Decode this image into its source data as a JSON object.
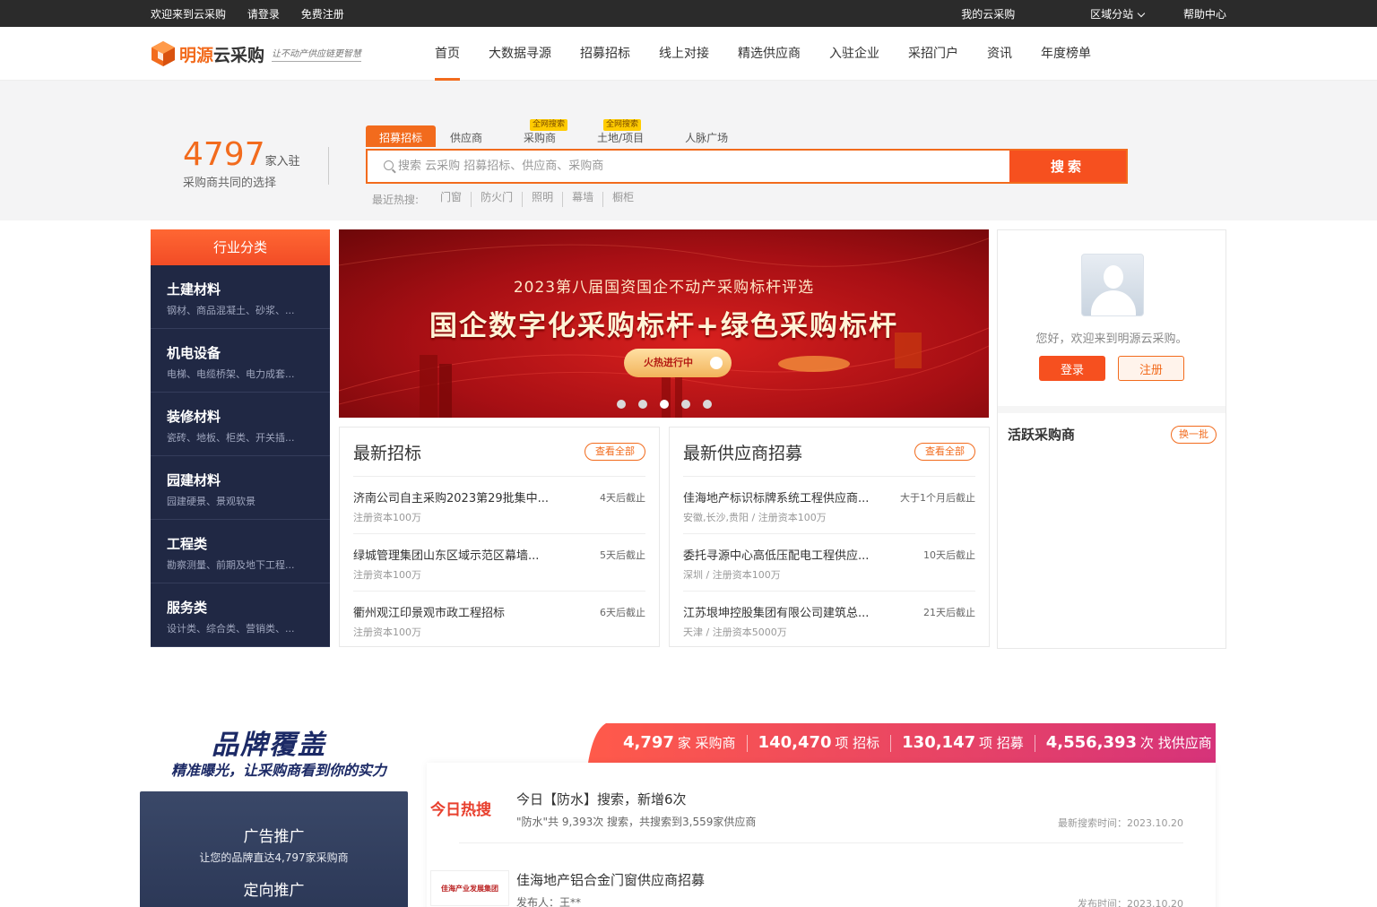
{
  "topbar": {
    "welcome": "欢迎来到云采购",
    "login": "请登录",
    "register": "免费注册",
    "my": "我的云采购",
    "region": "区域分站",
    "help": "帮助中心"
  },
  "header": {
    "logo_brand": "明源",
    "logo_product": "云采购",
    "slogan": "让不动产供应链更智慧",
    "nav": [
      "首页",
      "大数据寻源",
      "招募招标",
      "线上对接",
      "精选供应商",
      "入驻企业",
      "采招门户",
      "资讯",
      "年度榜单"
    ],
    "active_nav": "首页"
  },
  "search": {
    "stat_number": "4797",
    "stat_unit": "家入驻",
    "stat_sub": "采购商共同的选择",
    "tabs": [
      {
        "label": "招募招标",
        "badge": ""
      },
      {
        "label": "供应商",
        "badge": ""
      },
      {
        "label": "采购商",
        "badge": "全网搜索"
      },
      {
        "label": "土地/项目",
        "badge": "全网搜索"
      },
      {
        "label": "人脉广场",
        "badge": ""
      }
    ],
    "placeholder": "搜索 云采购 招募招标、供应商、采购商",
    "button": "搜索",
    "hot_label": "最近热搜:",
    "hot": [
      "门窗",
      "防火门",
      "照明",
      "幕墙",
      "橱柜"
    ]
  },
  "categories": {
    "title": "行业分类",
    "items": [
      {
        "title": "土建材料",
        "desc": "钢材、商品混凝土、砂浆、..."
      },
      {
        "title": "机电设备",
        "desc": "电梯、电缆桥架、电力成套..."
      },
      {
        "title": "装修材料",
        "desc": "瓷砖、地板、柜类、开关插..."
      },
      {
        "title": "园建材料",
        "desc": "园建硬景、景观软景"
      },
      {
        "title": "工程类",
        "desc": "勘察测量、前期及地下工程..."
      },
      {
        "title": "服务类",
        "desc": "设计类、综合类、营销类、..."
      }
    ]
  },
  "banner": {
    "subtitle": "2023第八届国资国企不动产采购标杆评选",
    "title": "国企数字化采购标杆+绿色采购标杆",
    "button": "火热进行中",
    "slide_count": 5,
    "active_slide": 2
  },
  "tenders": {
    "title": "最新招标",
    "view_all": "查看全部",
    "rows": [
      {
        "title": "济南公司自主采购2023第29批集中...",
        "sub": "注册资本100万",
        "deadline": "4天后截止"
      },
      {
        "title": "绿城管理集团山东区域示范区幕墙...",
        "sub": "注册资本100万",
        "deadline": "5天后截止"
      },
      {
        "title": "衢州观江印景观市政工程招标",
        "sub": "注册资本100万",
        "deadline": "6天后截止"
      }
    ]
  },
  "suppliers": {
    "title": "最新供应商招募",
    "view_all": "查看全部",
    "rows": [
      {
        "title": "佳海地产标识标牌系统工程供应商...",
        "sub": "安徽,长沙,贵阳 / 注册资本100万",
        "deadline": "大于1个月后截止"
      },
      {
        "title": "委托寻源中心高低压配电工程供应...",
        "sub": "深圳 / 注册资本100万",
        "deadline": "10天后截止"
      },
      {
        "title": "江苏垠坤控股集团有限公司建筑总...",
        "sub": "天津 / 注册资本5000万",
        "deadline": "21天后截止"
      }
    ]
  },
  "user_card": {
    "greeting": "您好，欢迎来到明源云采购。",
    "login": "登录",
    "register": "注册",
    "active_title": "活跃采购商",
    "swap": "换一批"
  },
  "brand": {
    "title": "品牌覆盖",
    "subtitle": "精准曝光，让采购商看到你的实力",
    "ad1": "广告推广",
    "ad1_sub": "让您的品牌直达4,797家采购商",
    "ad2": "定向推广"
  },
  "stats": [
    {
      "num": "4,797",
      "unit": "家 采购商"
    },
    {
      "num": "140,470",
      "unit": "项 招标"
    },
    {
      "num": "130,147",
      "unit": "项 招募"
    },
    {
      "num": "4,556,393",
      "unit": "次 找供应商"
    }
  ],
  "feed": [
    {
      "logo": "今日热搜",
      "title": "今日【防水】搜索，新增6次",
      "desc": "\"防水\"共 9,393次 搜索，共搜索到3,559家供应商",
      "time": "最新搜索时间：2023.10.20"
    },
    {
      "logo": "佳海产业发展集团",
      "title": "佳海地产铝合金门窗供应商招募",
      "desc": "发布人：王**",
      "time": "发布时间：2023.10.20"
    }
  ],
  "colors": {
    "accent": "#f26b1d",
    "dark": "#202844",
    "topbar": "#2b2b2b"
  }
}
